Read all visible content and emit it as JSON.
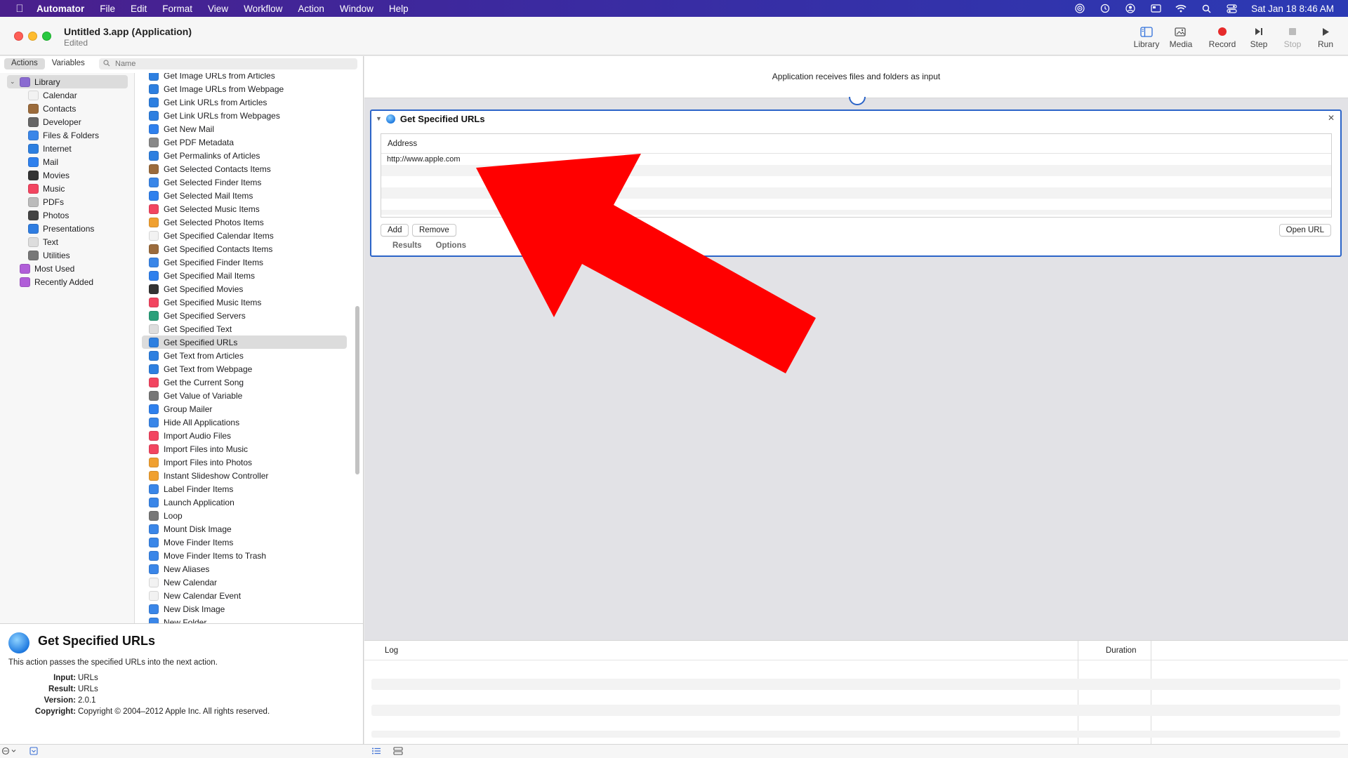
{
  "menubar": {
    "app": "Automator",
    "items": [
      "File",
      "Edit",
      "Format",
      "View",
      "Workflow",
      "Action",
      "Window",
      "Help"
    ],
    "datetime": "Sat Jan 18  8:46 AM"
  },
  "window": {
    "title": "Untitled 3.app (Application)",
    "subtitle": "Edited"
  },
  "toolbar": {
    "library": "Library",
    "media": "Media",
    "record": "Record",
    "step": "Step",
    "stop": "Stop",
    "run": "Run"
  },
  "library_pane": {
    "tabs": [
      "Actions",
      "Variables"
    ],
    "search_placeholder": "Name",
    "tree": [
      {
        "label": "Library",
        "color": "#8a6bd1"
      },
      {
        "label": "Calendar",
        "color": "#f2f2f2"
      },
      {
        "label": "Contacts",
        "color": "#9b6b3c"
      },
      {
        "label": "Developer",
        "color": "#666666"
      },
      {
        "label": "Files & Folders",
        "color": "#3a86e8"
      },
      {
        "label": "Internet",
        "color": "#2d7fe0"
      },
      {
        "label": "Mail",
        "color": "#2f80ed"
      },
      {
        "label": "Movies",
        "color": "#333333"
      },
      {
        "label": "Music",
        "color": "#f24560"
      },
      {
        "label": "PDFs",
        "color": "#bbbbbb"
      },
      {
        "label": "Photos",
        "color": "#444444"
      },
      {
        "label": "Presentations",
        "color": "#2f7de1"
      },
      {
        "label": "Text",
        "color": "#dddddd"
      },
      {
        "label": "Utilities",
        "color": "#777777"
      },
      {
        "label": "Most Used",
        "color": "#b05ed8"
      },
      {
        "label": "Recently Added",
        "color": "#b05ed8"
      }
    ],
    "actions": [
      {
        "label": "Get Image URLs from Articles",
        "color": "#2d7fe0"
      },
      {
        "label": "Get Image URLs from Webpage",
        "color": "#2d7fe0"
      },
      {
        "label": "Get Link URLs from Articles",
        "color": "#2d7fe0"
      },
      {
        "label": "Get Link URLs from Webpages",
        "color": "#2d7fe0"
      },
      {
        "label": "Get New Mail",
        "color": "#2f80ed"
      },
      {
        "label": "Get PDF Metadata",
        "color": "#888888"
      },
      {
        "label": "Get Permalinks of Articles",
        "color": "#2d7fe0"
      },
      {
        "label": "Get Selected Contacts Items",
        "color": "#9b6b3c"
      },
      {
        "label": "Get Selected Finder Items",
        "color": "#3a86e8"
      },
      {
        "label": "Get Selected Mail Items",
        "color": "#2f80ed"
      },
      {
        "label": "Get Selected Music Items",
        "color": "#f24560"
      },
      {
        "label": "Get Selected Photos Items",
        "color": "#f0a030"
      },
      {
        "label": "Get Specified Calendar Items",
        "color": "#f2f2f2"
      },
      {
        "label": "Get Specified Contacts Items",
        "color": "#9b6b3c"
      },
      {
        "label": "Get Specified Finder Items",
        "color": "#3a86e8"
      },
      {
        "label": "Get Specified Mail Items",
        "color": "#2f80ed"
      },
      {
        "label": "Get Specified Movies",
        "color": "#333333"
      },
      {
        "label": "Get Specified Music Items",
        "color": "#f24560"
      },
      {
        "label": "Get Specified Servers",
        "color": "#2aa07a"
      },
      {
        "label": "Get Specified Text",
        "color": "#dddddd"
      },
      {
        "label": "Get Specified URLs",
        "color": "#2d7fe0"
      },
      {
        "label": "Get Text from Articles",
        "color": "#2d7fe0"
      },
      {
        "label": "Get Text from Webpage",
        "color": "#2d7fe0"
      },
      {
        "label": "Get the Current Song",
        "color": "#f24560"
      },
      {
        "label": "Get Value of Variable",
        "color": "#777777"
      },
      {
        "label": "Group Mailer",
        "color": "#2f80ed"
      },
      {
        "label": "Hide All Applications",
        "color": "#3a86e8"
      },
      {
        "label": "Import Audio Files",
        "color": "#f24560"
      },
      {
        "label": "Import Files into Music",
        "color": "#f24560"
      },
      {
        "label": "Import Files into Photos",
        "color": "#f0a030"
      },
      {
        "label": "Instant Slideshow Controller",
        "color": "#f0a030"
      },
      {
        "label": "Label Finder Items",
        "color": "#3a86e8"
      },
      {
        "label": "Launch Application",
        "color": "#3a86e8"
      },
      {
        "label": "Loop",
        "color": "#777777"
      },
      {
        "label": "Mount Disk Image",
        "color": "#3a86e8"
      },
      {
        "label": "Move Finder Items",
        "color": "#3a86e8"
      },
      {
        "label": "Move Finder Items to Trash",
        "color": "#3a86e8"
      },
      {
        "label": "New Aliases",
        "color": "#3a86e8"
      },
      {
        "label": "New Calendar",
        "color": "#f2f2f2"
      },
      {
        "label": "New Calendar Event",
        "color": "#f2f2f2"
      },
      {
        "label": "New Disk Image",
        "color": "#3a86e8"
      },
      {
        "label": "New Folder",
        "color": "#3a86e8"
      }
    ],
    "selected_action": "Get Specified URLs"
  },
  "description": {
    "title": "Get Specified URLs",
    "text": "This action passes the specified URLs into the next action.",
    "fields": [
      {
        "key": "Input:",
        "value": "URLs"
      },
      {
        "key": "Result:",
        "value": "URLs"
      },
      {
        "key": "Version:",
        "value": "2.0.1"
      },
      {
        "key": "Copyright:",
        "value": "Copyright © 2004–2012 Apple Inc.  All rights reserved."
      }
    ]
  },
  "workflow": {
    "input_text": "Application receives files and folders as input",
    "action": {
      "title": "Get Specified URLs",
      "column_header": "Address",
      "urls": [
        "http://www.apple.com"
      ],
      "add_label": "Add",
      "remove_label": "Remove",
      "open_url_label": "Open URL",
      "tabs": [
        "Results",
        "Options"
      ]
    }
  },
  "log": {
    "col_log": "Log",
    "col_duration": "Duration"
  },
  "annotation": {
    "arrow_color": "#ff0000"
  }
}
